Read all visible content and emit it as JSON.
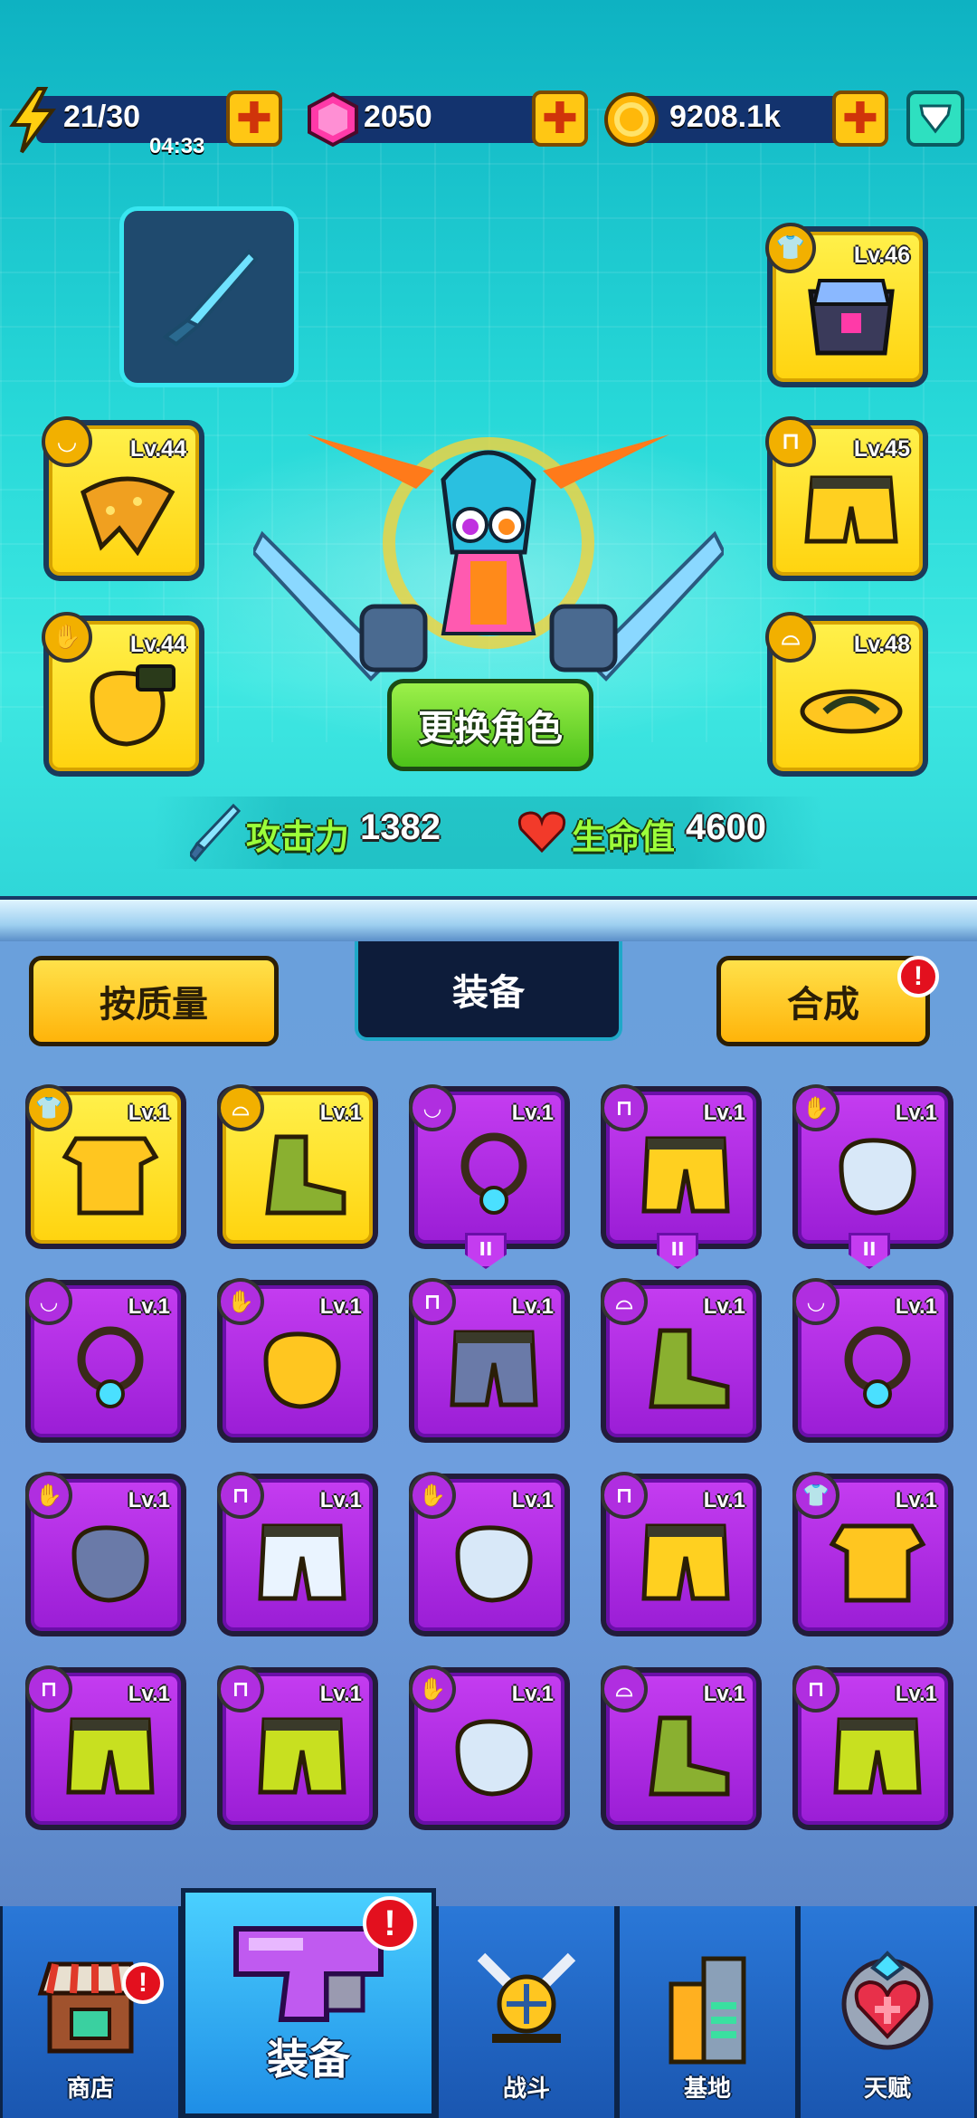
{
  "resources": {
    "energy": {
      "value": "21/30",
      "timer": "04:33"
    },
    "gems": {
      "value": "2050"
    },
    "coins": {
      "value": "9208.1k"
    },
    "plus_symbol": "✚"
  },
  "equipped": {
    "left": [
      {
        "level": "Lv.44",
        "type": "necklace",
        "item": "yellow bandana"
      },
      {
        "level": "Lv.44",
        "type": "glove",
        "item": "yellow glove"
      }
    ],
    "right": [
      {
        "level": "Lv.46",
        "type": "armor",
        "item": "crystal armor"
      },
      {
        "level": "Lv.45",
        "type": "pants",
        "item": "yellow shorts"
      },
      {
        "level": "Lv.48",
        "type": "shoes",
        "item": "yellow flip-flops"
      }
    ]
  },
  "character": {
    "swap_button": "更换角色"
  },
  "stats": {
    "attack_label": "攻击力",
    "attack_value": "1382",
    "hp_label": "生命值",
    "hp_value": "4600"
  },
  "inventory": {
    "sort_button": "按质量",
    "tab_title": "装备",
    "merge_button": "合成",
    "alert_symbol": "!",
    "pause_symbol": "II",
    "items": [
      {
        "level": "Lv.1",
        "rarity": "yellow",
        "type": "armor",
        "item": "hawaiian shirt"
      },
      {
        "level": "Lv.1",
        "rarity": "yellow",
        "type": "shoes",
        "item": "flip-flops"
      },
      {
        "level": "Lv.1",
        "rarity": "purple",
        "type": "necklace",
        "item": "bandana",
        "tag": true
      },
      {
        "level": "Lv.1",
        "rarity": "purple",
        "type": "pants",
        "item": "yellow shorts",
        "tag": true
      },
      {
        "level": "Lv.1",
        "rarity": "purple",
        "type": "glove",
        "item": "boxing glove",
        "tag": true
      },
      {
        "level": "Lv.1",
        "rarity": "purple",
        "type": "necklace",
        "item": "dog tag collar"
      },
      {
        "level": "Lv.1",
        "rarity": "purple",
        "type": "glove",
        "item": "yellow glove"
      },
      {
        "level": "Lv.1",
        "rarity": "purple",
        "type": "pants",
        "item": "mech pants"
      },
      {
        "level": "Lv.1",
        "rarity": "purple",
        "type": "shoes",
        "item": "combat boot"
      },
      {
        "level": "Lv.1",
        "rarity": "purple",
        "type": "necklace",
        "item": "gem pendant"
      },
      {
        "level": "Lv.1",
        "rarity": "purple",
        "type": "glove",
        "item": "mech gauntlet"
      },
      {
        "level": "Lv.1",
        "rarity": "purple",
        "type": "pants",
        "item": "white briefs"
      },
      {
        "level": "Lv.1",
        "rarity": "purple",
        "type": "glove",
        "item": "white glove"
      },
      {
        "level": "Lv.1",
        "rarity": "purple",
        "type": "pants",
        "item": "yellow shorts"
      },
      {
        "level": "Lv.1",
        "rarity": "purple",
        "type": "armor",
        "item": "camo vest"
      },
      {
        "level": "Lv.1",
        "rarity": "purple",
        "type": "pants",
        "item": "camo pants"
      },
      {
        "level": "Lv.1",
        "rarity": "purple",
        "type": "pants",
        "item": "camo pants"
      },
      {
        "level": "Lv.1",
        "rarity": "purple",
        "type": "glove",
        "item": "white glove"
      },
      {
        "level": "Lv.1",
        "rarity": "purple",
        "type": "shoes",
        "item": "white sock"
      },
      {
        "level": "Lv.1",
        "rarity": "purple",
        "type": "pants",
        "item": "camo pants"
      }
    ]
  },
  "nav": [
    {
      "label": "商店",
      "icon": "shop-icon",
      "alert": true
    },
    {
      "label": "装备",
      "icon": "equipment-gun-icon",
      "alert": true,
      "active": true
    },
    {
      "label": "战斗",
      "icon": "battle-icon"
    },
    {
      "label": "基地",
      "icon": "base-icon"
    },
    {
      "label": "天赋",
      "icon": "talent-icon"
    }
  ],
  "colors": {
    "yellow_rarity": "#ffd410",
    "purple_rarity": "#a32ad8",
    "accent_green": "#9cff3a",
    "alert_red": "#e3101e"
  }
}
